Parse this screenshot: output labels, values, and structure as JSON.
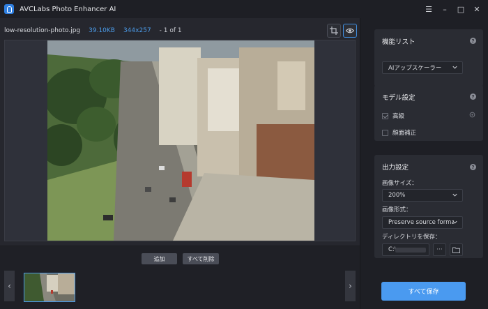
{
  "app": {
    "title": "AVCLabs Photo Enhancer AI"
  },
  "window_controls": {
    "menu": "☰",
    "minimize": "–",
    "maximize": "□",
    "close": "✕"
  },
  "file": {
    "name": "low-resolution-photo.jpg",
    "size": "39.10KB",
    "dimensions": "344x257",
    "count": "- 1 of 1"
  },
  "bottom": {
    "add_label": "追加",
    "clear_all_label": "すべて削除",
    "prev": "‹",
    "next": "›"
  },
  "panel": {
    "features": {
      "title": "機能リスト",
      "selected": "AIアップスケーラー"
    },
    "model": {
      "title": "モデル設定",
      "options": [
        {
          "label": "高級",
          "checked": true
        },
        {
          "label": "顔面補正",
          "checked": false
        }
      ]
    },
    "output": {
      "title": "出力設定",
      "size_label": "画像サイズ：",
      "size_value": "200%",
      "format_label": "画像形式：",
      "format_value": "Preserve source forma",
      "dir_label": "ディレクトリを保存：",
      "dir_value": "C:\\",
      "dir_more": "···"
    },
    "save_all_label": "すべて保存"
  },
  "colors": {
    "accent": "#4a9af0",
    "panel_bg": "#2a2c33",
    "app_bg": "#1e1f25"
  }
}
